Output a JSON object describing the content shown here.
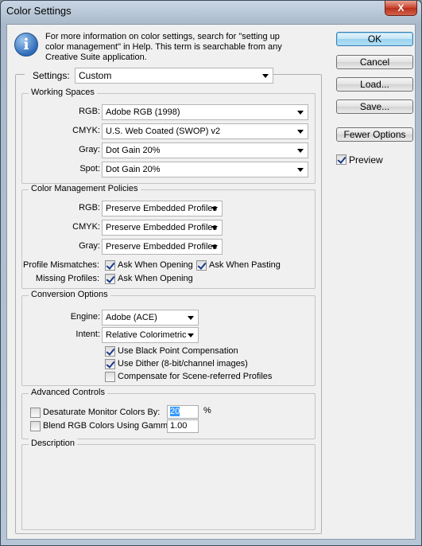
{
  "window": {
    "title": "Color Settings",
    "close_label": "X"
  },
  "info": {
    "icon_glyph": "i",
    "line1": "For more information on color settings, search for \"setting up",
    "line2": "color management\" in Help. This term is searchable from any",
    "line3": "Creative Suite application."
  },
  "settings": {
    "label": "Settings:",
    "value": "Custom"
  },
  "working_spaces": {
    "title": "Working Spaces",
    "rgb_label": "RGB:",
    "rgb_value": "Adobe RGB (1998)",
    "cmyk_label": "CMYK:",
    "cmyk_value": "U.S. Web Coated (SWOP) v2",
    "gray_label": "Gray:",
    "gray_value": "Dot Gain 20%",
    "spot_label": "Spot:",
    "spot_value": "Dot Gain 20%"
  },
  "policies": {
    "title": "Color Management Policies",
    "rgb_label": "RGB:",
    "rgb_value": "Preserve Embedded Profiles",
    "cmyk_label": "CMYK:",
    "cmyk_value": "Preserve Embedded Profiles",
    "gray_label": "Gray:",
    "gray_value": "Preserve Embedded Profiles",
    "mismatch_label": "Profile Mismatches:",
    "ask_opening": "Ask When Opening",
    "ask_pasting": "Ask When Pasting",
    "missing_label": "Missing Profiles:",
    "missing_ask_opening": "Ask When Opening"
  },
  "conversion": {
    "title": "Conversion Options",
    "engine_label": "Engine:",
    "engine_value": "Adobe (ACE)",
    "intent_label": "Intent:",
    "intent_value": "Relative Colorimetric",
    "black_point": "Use Black Point Compensation",
    "dither": "Use Dither (8-bit/channel images)",
    "scene_referred": "Compensate for Scene-referred Profiles"
  },
  "advanced": {
    "title": "Advanced Controls",
    "desaturate_label": "Desaturate Monitor Colors By:",
    "desaturate_value": "20",
    "percent": "%",
    "blend_label": "Blend RGB Colors Using Gamma:",
    "blend_value": "1.00"
  },
  "description": {
    "title": "Description"
  },
  "buttons": {
    "ok": "OK",
    "cancel": "Cancel",
    "load": "Load...",
    "save": "Save...",
    "fewer_options": "Fewer Options"
  },
  "preview": {
    "label": "Preview"
  }
}
